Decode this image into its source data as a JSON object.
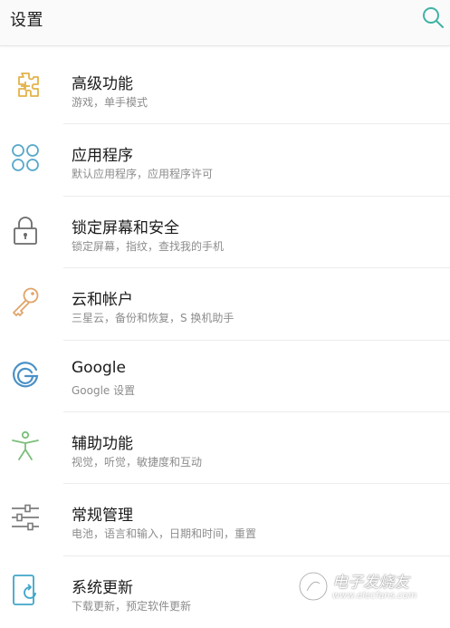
{
  "header": {
    "title": "设置"
  },
  "colors": {
    "accent": "#3fb3a6",
    "advanced_icon": "#e3b34a",
    "apps_icon": "#58a9c9",
    "lock_icon": "#6b6b6b",
    "account_icon": "#e0a46a",
    "google_icon": "#4a91c7",
    "accessibility_icon": "#7bbf7a",
    "general_icon": "#7c7c7c",
    "update_icon": "#3fa6c9"
  },
  "items": [
    {
      "icon": "plus-puzzle-icon",
      "label": "高级功能",
      "sub": "游戏，单手模式"
    },
    {
      "icon": "apps-grid-icon",
      "label": "应用程序",
      "sub": "默认应用程序，应用程序许可"
    },
    {
      "icon": "lock-icon",
      "label": "锁定屏幕和安全",
      "sub": "锁定屏幕，指纹，查找我的手机"
    },
    {
      "icon": "key-icon",
      "label": "云和帐户",
      "sub": "三星云，备份和恢复，S 换机助手"
    },
    {
      "icon": "google-icon",
      "label": "Google",
      "sub": "Google 设置"
    },
    {
      "icon": "accessibility-icon",
      "label": "辅助功能",
      "sub": "视觉，听觉，敏捷度和互动"
    },
    {
      "icon": "sliders-icon",
      "label": "常规管理",
      "sub": "电池，语言和输入，日期和时间，重置"
    },
    {
      "icon": "system-update-icon",
      "label": "系统更新",
      "sub": "下载更新，预定软件更新"
    }
  ],
  "watermark": {
    "main": "电子发烧友",
    "url": "www.elecfans.com"
  }
}
